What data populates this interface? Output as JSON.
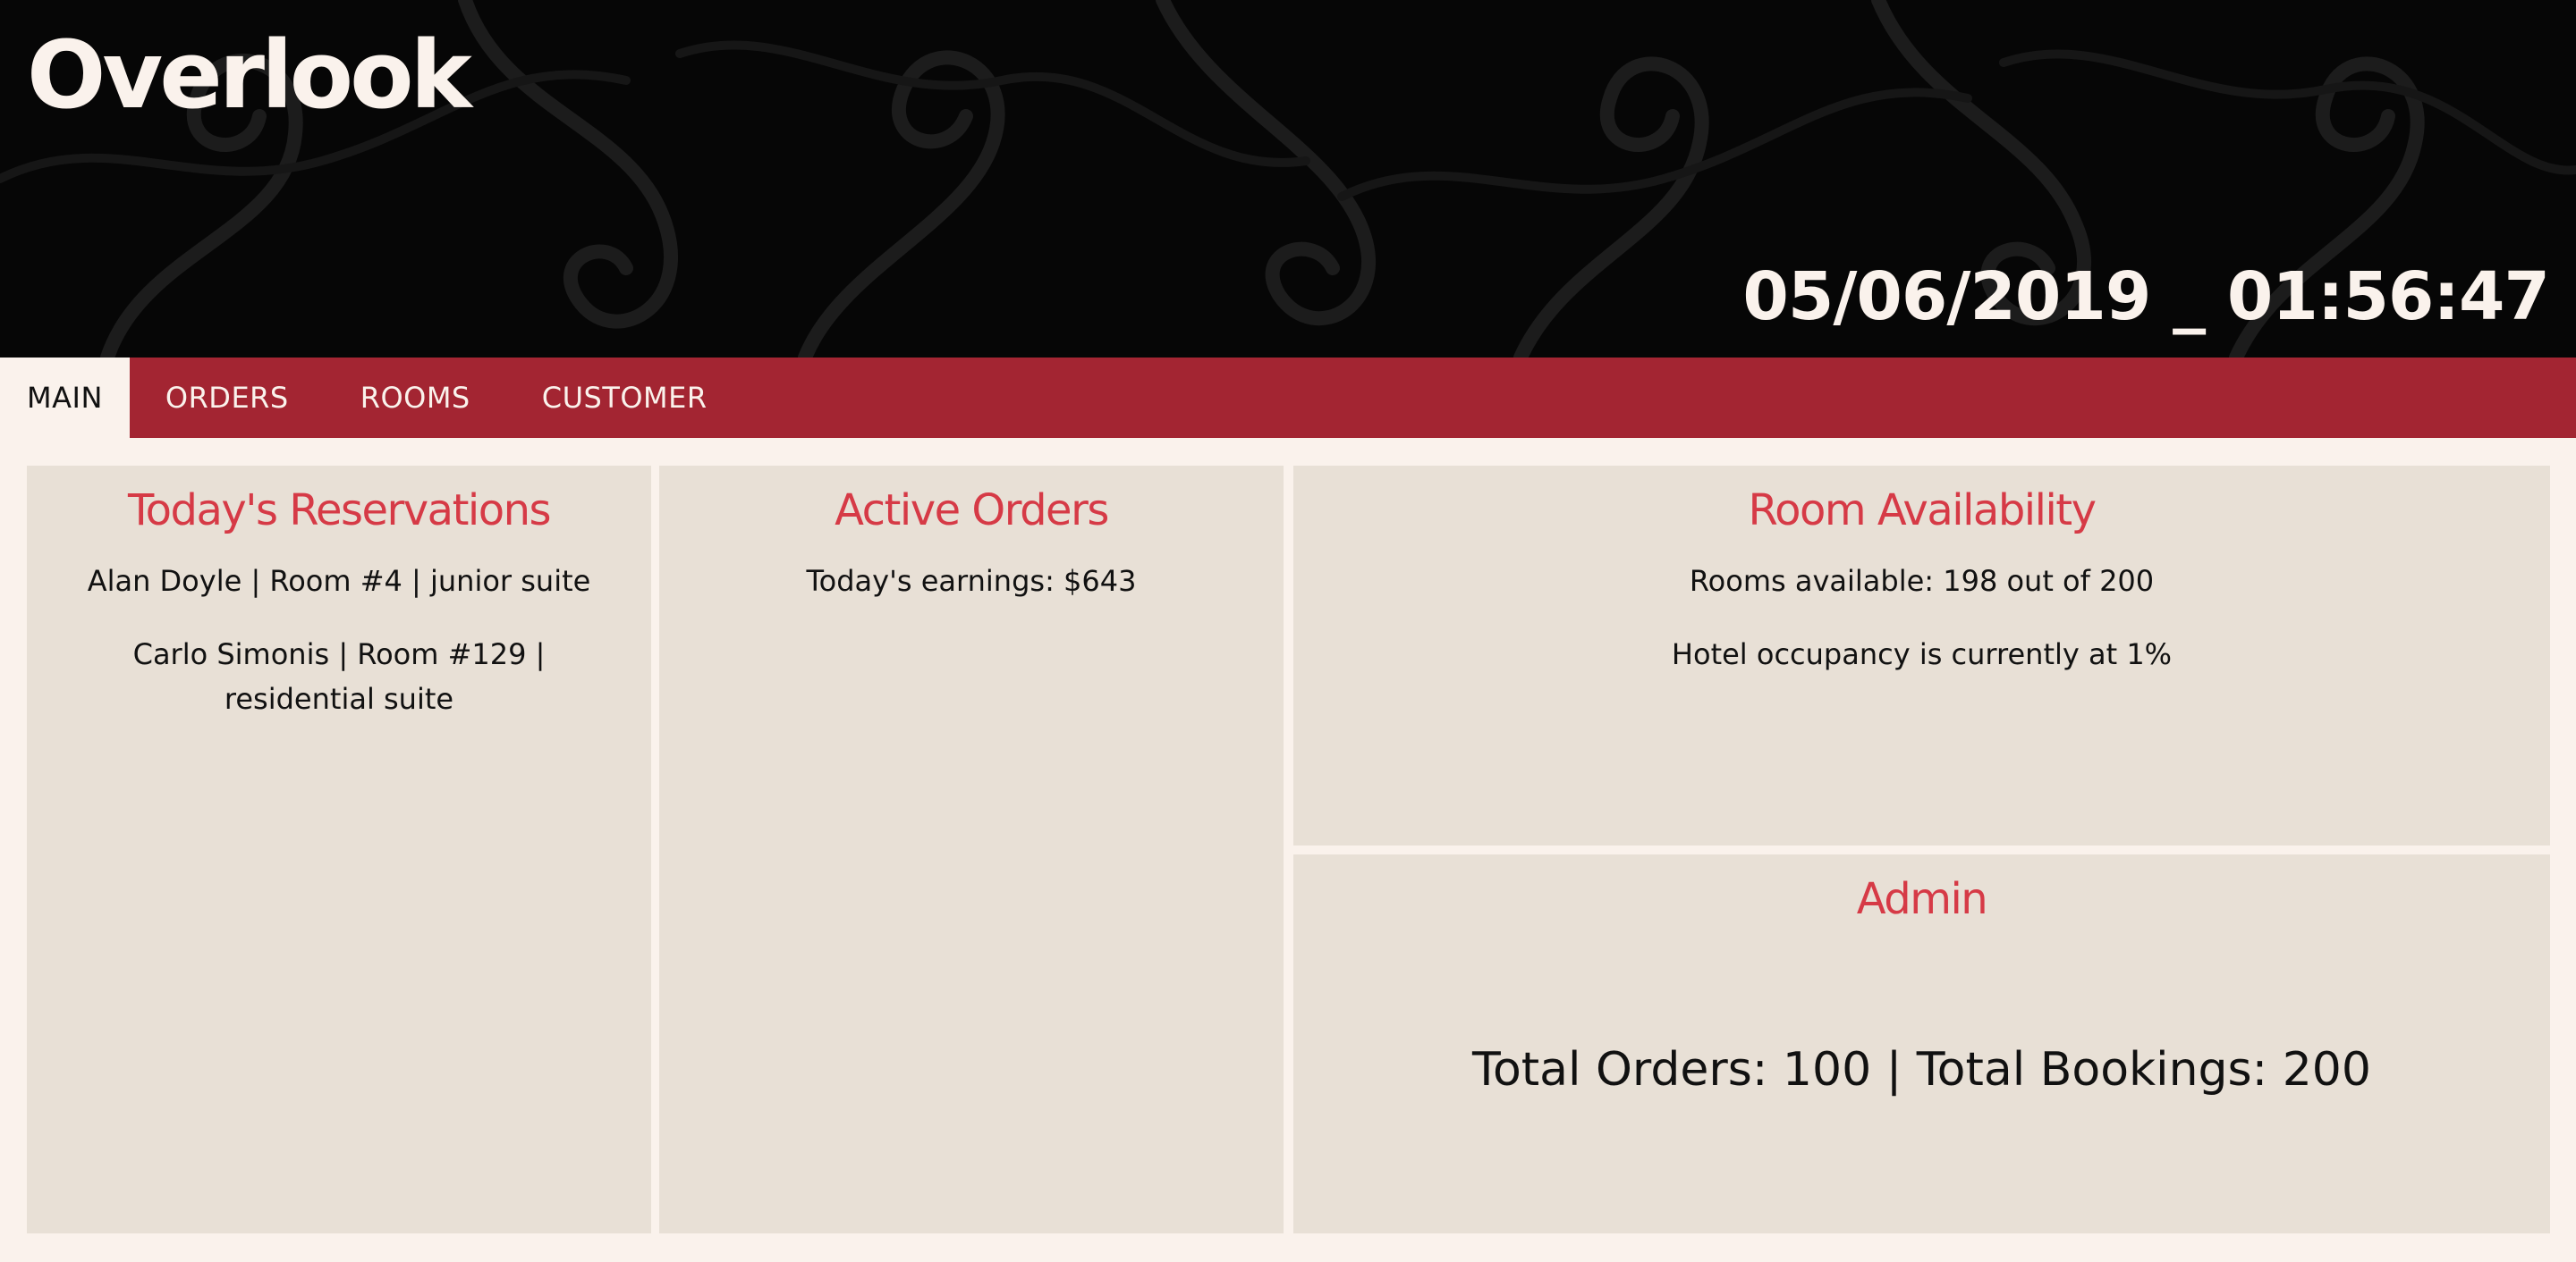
{
  "app": {
    "title": "Overlook",
    "datetime": "05/06/2019 _ 01:56:47"
  },
  "colors": {
    "header_bg": "#060606",
    "nav_bg": "#a32532",
    "page_bg": "#faf2ec",
    "panel_bg": "#e8e0d6",
    "heading": "#d63a46"
  },
  "nav": {
    "tabs": [
      {
        "label": "MAIN",
        "active": true
      },
      {
        "label": "ORDERS",
        "active": false
      },
      {
        "label": "ROOMS",
        "active": false
      },
      {
        "label": "CUSTOMER",
        "active": false
      }
    ]
  },
  "reservations": {
    "title": "Today's Reservations",
    "items": [
      "Alan Doyle | Room #4 | junior suite",
      "Carlo Simonis | Room #129 | residential suite"
    ]
  },
  "orders": {
    "title": "Active Orders",
    "earnings": "Today's earnings: $643"
  },
  "rooms": {
    "title": "Room Availability",
    "available": "Rooms available: 198 out of 200",
    "occupancy": "Hotel occupancy is currently at 1%"
  },
  "admin": {
    "title": "Admin",
    "totals": "Total Orders: 100 | Total Bookings: 200"
  }
}
